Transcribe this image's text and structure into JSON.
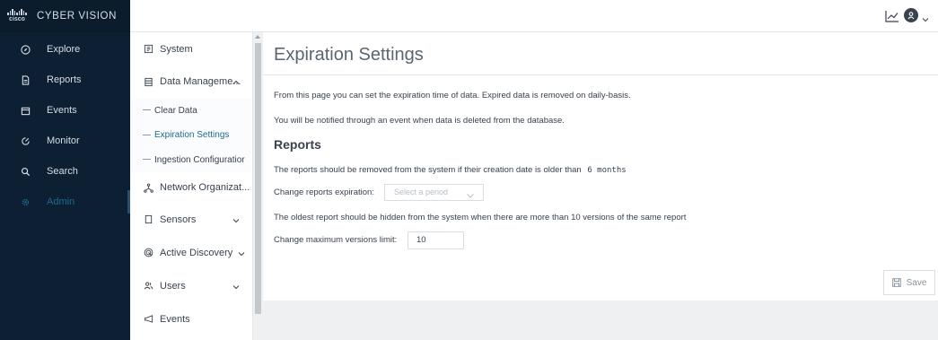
{
  "brand": {
    "logo_text": "cisco",
    "title": "CYBER VISION"
  },
  "nav": {
    "items": [
      {
        "label": "Explore",
        "icon": "compass-icon"
      },
      {
        "label": "Reports",
        "icon": "report-icon"
      },
      {
        "label": "Events",
        "icon": "calendar-icon"
      },
      {
        "label": "Monitor",
        "icon": "monitor-icon"
      },
      {
        "label": "Search",
        "icon": "search-icon"
      },
      {
        "label": "Admin",
        "icon": "gear-icon"
      }
    ]
  },
  "subnav": {
    "system": "System",
    "data_management": "Data Manageme...",
    "children": [
      "Clear Data",
      "Expiration Settings",
      "Ingestion Configuratior"
    ],
    "network_org": "Network Organizat...",
    "sensors": "Sensors",
    "active_discovery": "Active Discovery",
    "users": "Users",
    "events": "Events"
  },
  "main": {
    "title": "Expiration Settings",
    "intro_1": "From this page you can set the expiration time of data. Expired data is removed on daily-basis.",
    "intro_2": "You will be notified through an event when data is deleted from the database.",
    "section": "Reports",
    "reports_text": "The reports should be removed from the system if their creation date is older than",
    "reports_value": "6 months",
    "change_expiration_label": "Change reports expiration:",
    "select_placeholder": "Select a period",
    "versions_text": "The oldest report should be hidden from the system when there are more than 10 versions of the same report",
    "change_versions_label": "Change maximum versions limit:",
    "versions_value": "10",
    "save_label": "Save"
  },
  "colors": {
    "nav_bg": "#0d2033",
    "accent": "#1e6a8c"
  }
}
